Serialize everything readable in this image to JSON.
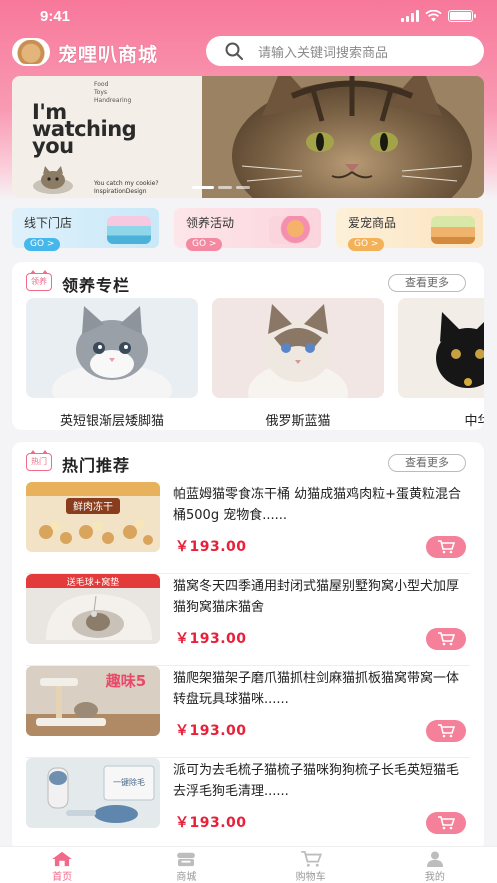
{
  "status_bar": {
    "time": "9:41"
  },
  "header": {
    "app_name": "宠哩叭商城",
    "search_placeholder": "请输入关键词搜索商品"
  },
  "banner": {
    "small_lines": [
      "Food",
      "Toys",
      "Handrearing"
    ],
    "headline": [
      "I'm",
      "watching",
      "you"
    ],
    "tagline": [
      "You catch my cookie?",
      "InspirationDesign"
    ]
  },
  "quick_entries": [
    {
      "label": "线下门店",
      "go": "GO >"
    },
    {
      "label": "领养活动",
      "go": "GO >"
    },
    {
      "label": "爱宠商品",
      "go": "GO >"
    }
  ],
  "adopt_section": {
    "icon_text": "领养",
    "title": "领养专栏",
    "more": "查看更多",
    "items": [
      {
        "name": "英短银渐层矮脚猫"
      },
      {
        "name": "俄罗斯蓝猫"
      },
      {
        "name": "中华田"
      }
    ]
  },
  "hot_section": {
    "icon_text": "热门",
    "title": "热门推荐",
    "more": "查看更多",
    "products": [
      {
        "title": "帕蓝姆猫零食冻干桶 幼猫成猫鸡肉粒+蛋黄粒混合桶500g 宠物食......",
        "price": "￥193.00",
        "thumb_text": "鲜肉冻干"
      },
      {
        "title": "猫窝冬天四季通用封闭式猫屋别墅狗窝小型犬加厚猫狗窝猫床猫舍",
        "price": "￥193.00",
        "thumb_text": "送毛球+窝垫"
      },
      {
        "title": "猫爬架猫架子磨爪猫抓柱剑麻猫抓板猫窝带窝一体转盘玩具球猫咪......",
        "price": "￥193.00",
        "thumb_text": "趣味5"
      },
      {
        "title": "派可为去毛梳子猫梳子猫咪狗狗梳子长毛英短猫毛去浮毛狗毛清理......",
        "price": "￥193.00",
        "thumb_text": "一键除毛"
      }
    ]
  },
  "tabbar": [
    {
      "label": "首页",
      "active": true
    },
    {
      "label": "商城",
      "active": false
    },
    {
      "label": "购物车",
      "active": false
    },
    {
      "label": "我的",
      "active": false
    }
  ],
  "colors": {
    "accent": "#f06a89",
    "price": "#e8203a",
    "header_pink": "#f7789a"
  }
}
